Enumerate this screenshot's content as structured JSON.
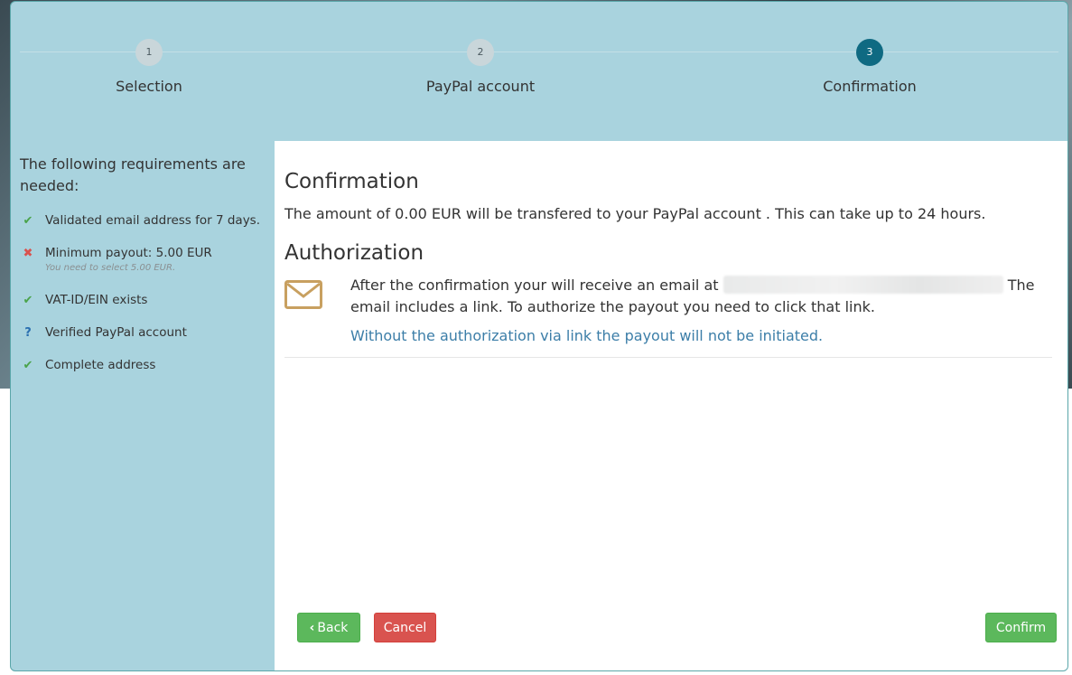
{
  "stepper": {
    "steps": [
      {
        "number": "1",
        "label": "Selection"
      },
      {
        "number": "2",
        "label": "PayPal account"
      },
      {
        "number": "3",
        "label": "Confirmation"
      }
    ],
    "active_step": 3
  },
  "sidebar": {
    "title": "The following requirements are needed:",
    "items": [
      {
        "status": "check-icon",
        "label": "Validated email address for 7 days."
      },
      {
        "status": "cross-icon",
        "label": "Minimum payout: 5.00 EUR",
        "note": "You need to select 5.00 EUR."
      },
      {
        "status": "check-icon",
        "label": "VAT-ID/EIN exists"
      },
      {
        "status": "question-icon",
        "label": "Verified PayPal account"
      },
      {
        "status": "check-icon",
        "label": "Complete address"
      }
    ]
  },
  "main": {
    "confirmation_heading": "Confirmation",
    "confirmation_text": "The amount of 0.00 EUR will be transfered to your PayPal account . This can take up to 24 hours.",
    "authorization_heading": "Authorization",
    "auth_text_before": "After the confirmation your will receive an email at",
    "auth_text_after": "The email includes a link. To authorize the payout you need to click that link.",
    "auth_note": "Without the authorization via link the payout will not be initiated."
  },
  "buttons": {
    "back": "Back",
    "cancel": "Cancel",
    "confirm": "Confirm"
  },
  "colors": {
    "panel_bg": "#a9d3de",
    "active_step": "#0f6a82",
    "success": "#5cb85c",
    "danger": "#d9534f",
    "link": "#3c7ea8",
    "envelope": "#c8a060"
  }
}
